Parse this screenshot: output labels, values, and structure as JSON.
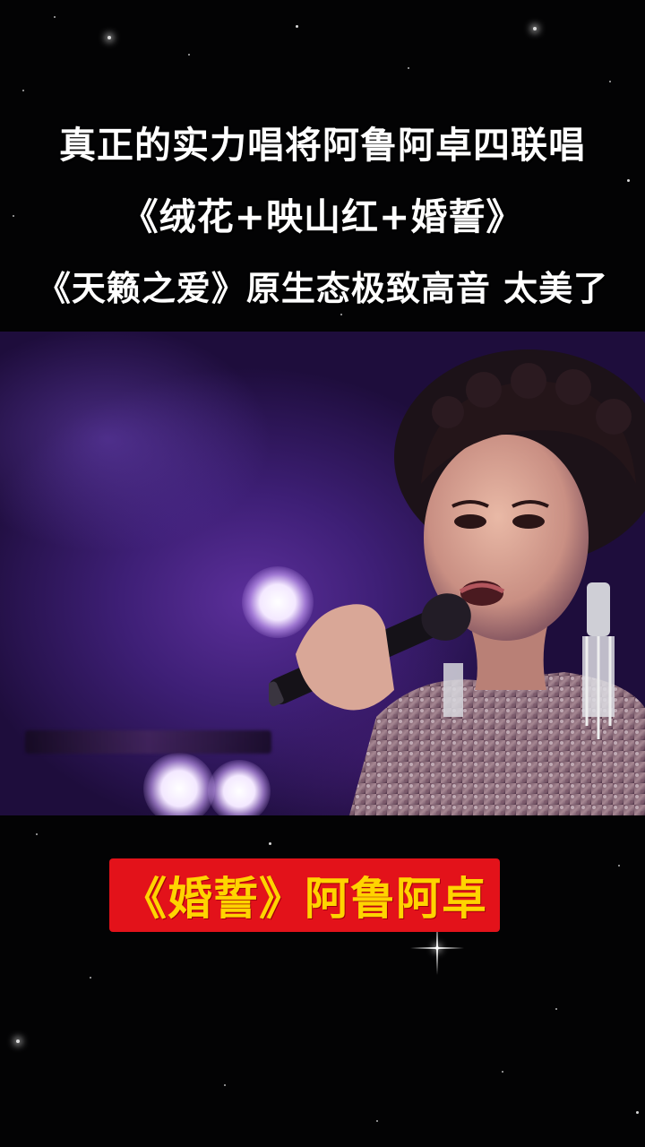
{
  "headline": {
    "line1": "真正的实力唱将阿鲁阿卓四联唱",
    "line2": "《绒花+映山红+婚誓》",
    "line3": "《天籁之爱》原生态极致高音 太美了"
  },
  "video": {
    "subject": "singer-performing"
  },
  "song_tag": {
    "text": "《婚誓》阿鲁阿卓"
  },
  "colors": {
    "background": "#030304",
    "headline_text": "#ffffff",
    "tag_background": "#e3121a",
    "tag_text": "#ffd400",
    "stage_purple": "#3e1f76"
  }
}
